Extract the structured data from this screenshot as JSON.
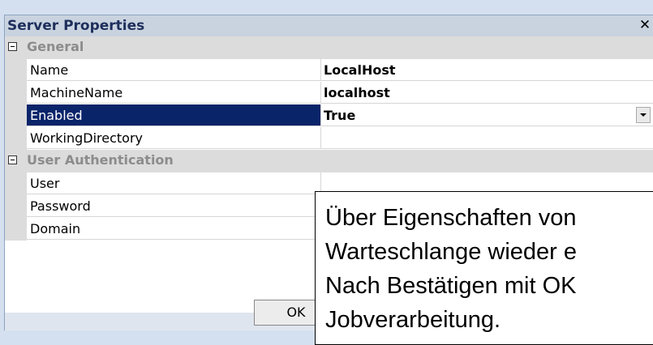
{
  "dialog": {
    "title": "Server Properties",
    "close_symbol": "✕"
  },
  "categories": [
    {
      "label": "General"
    },
    {
      "label": "User Authentication"
    }
  ],
  "general_props": [
    {
      "name": "Name",
      "value": "LocalHost"
    },
    {
      "name": "MachineName",
      "value": "localhost"
    },
    {
      "name": "Enabled",
      "value": "True",
      "selected": true,
      "has_dropdown": true
    },
    {
      "name": "WorkingDirectory",
      "value": ""
    }
  ],
  "auth_props": [
    {
      "name": "User",
      "value": ""
    },
    {
      "name": "Password",
      "value": ""
    },
    {
      "name": "Domain",
      "value": ""
    }
  ],
  "buttons": {
    "ok_label": "OK"
  },
  "callout": {
    "lines": [
      "Über Eigenschaften von",
      "Warteschlange wieder e",
      "Nach Bestätigen mit OK",
      "Jobverarbeitung."
    ]
  },
  "icons": {
    "collapse": "collapse-icon",
    "close": "close-icon",
    "dropdown": "chevron-down-icon"
  },
  "colors": {
    "selection": "#0a246a",
    "category_text": "#8c8c8c",
    "title_text": "#1e2f5b"
  }
}
